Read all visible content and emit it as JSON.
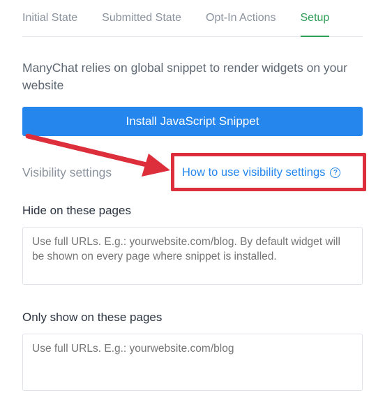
{
  "tabs": [
    {
      "label": "Initial State"
    },
    {
      "label": "Submitted State"
    },
    {
      "label": "Opt-In Actions"
    },
    {
      "label": "Setup",
      "active": true
    }
  ],
  "setup": {
    "intro_text": "ManyChat relies on global snippet to render widgets on your website",
    "install_button_label": "Install JavaScript Snippet",
    "visibility_label": "Visibility settings",
    "help_link_label": "How to use visibility settings",
    "help_icon_glyph": "?",
    "hide_title": "Hide on these pages",
    "hide_placeholder": "Use full URLs. E.g.: yourwebsite.com/blog. By default widget will be shown on every page where snippet is installed.",
    "show_title": "Only show on these pages",
    "show_placeholder": "Use full URLs. E.g.: yourwebsite.com/blog"
  },
  "colors": {
    "accent_blue": "#2587ee",
    "active_tab_green": "#2f9e57",
    "annotation_red": "#dc2e3b"
  }
}
